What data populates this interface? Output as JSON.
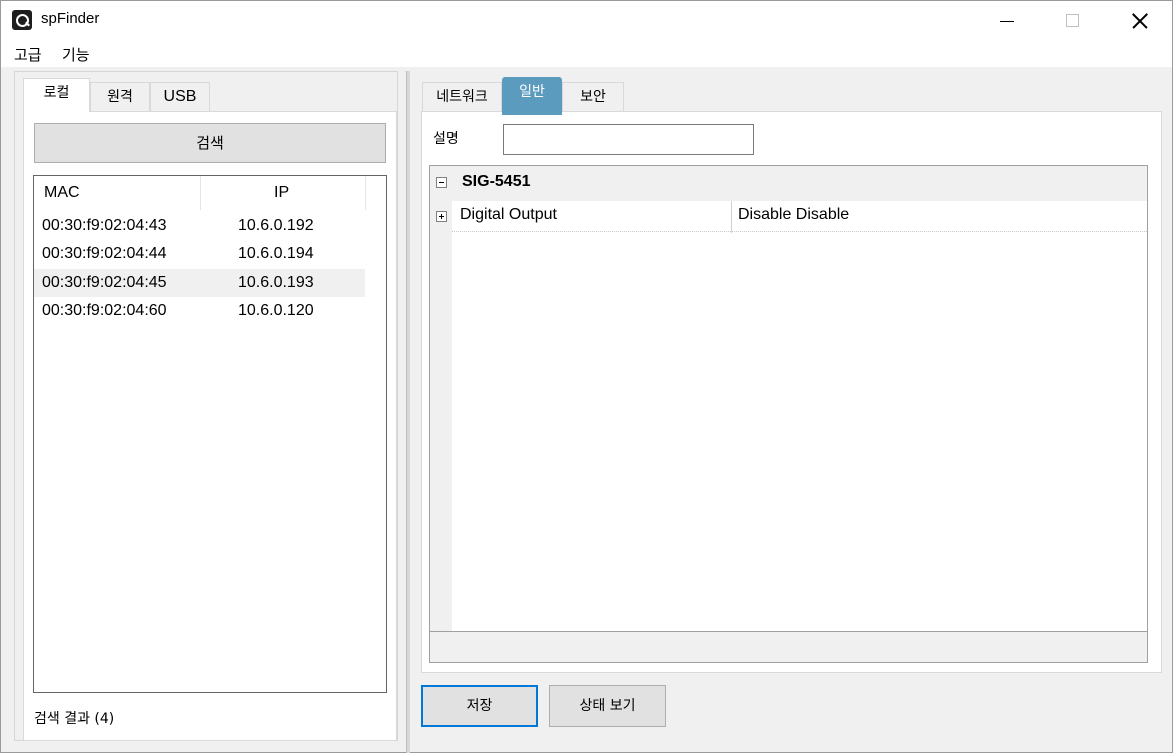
{
  "window": {
    "title": "spFinder"
  },
  "menu": {
    "items": [
      {
        "label": "고급"
      },
      {
        "label": "기능"
      }
    ]
  },
  "left": {
    "tabs": [
      {
        "label": "로컬"
      },
      {
        "label": "원격"
      },
      {
        "label": "USB"
      }
    ],
    "active_tab": 0,
    "search_button": "검색",
    "list": {
      "columns": [
        "MAC",
        "IP"
      ],
      "rows": [
        {
          "mac": "00:30:f9:02:04:43",
          "ip": "10.6.0.192"
        },
        {
          "mac": "00:30:f9:02:04:44",
          "ip": "10.6.0.194"
        },
        {
          "mac": "00:30:f9:02:04:45",
          "ip": "10.6.0.193"
        },
        {
          "mac": "00:30:f9:02:04:60",
          "ip": "10.6.0.120"
        }
      ],
      "selected_row": 2
    },
    "result_label": "검색 결과 (4)"
  },
  "right": {
    "tabs": [
      {
        "label": "네트워크"
      },
      {
        "label": "일반"
      },
      {
        "label": "보안"
      }
    ],
    "active_tab": 1,
    "active_tab_color": "#5b9bbd",
    "description": {
      "label": "설명",
      "value": ""
    },
    "property_grid": {
      "category": "SIG-5451",
      "rows": [
        {
          "name": "Digital Output",
          "value": "Disable Disable"
        }
      ]
    },
    "save_button": "저장",
    "status_button": "상태 보기"
  }
}
